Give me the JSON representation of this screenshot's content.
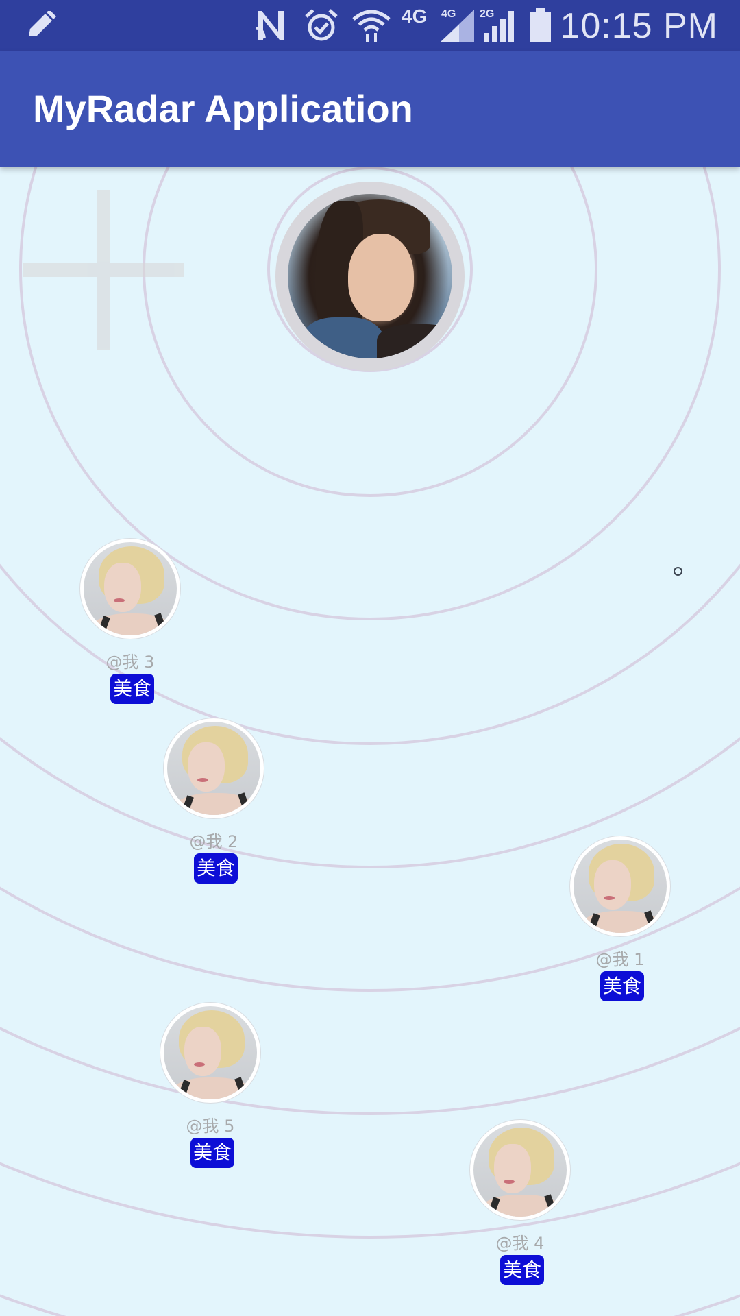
{
  "status_bar": {
    "time": "10:15 PM",
    "network_4g": "4G",
    "signal_4g_label": "4G",
    "signal_2g_label": "2G",
    "icons": [
      "edit-icon",
      "nfc-icon",
      "alarm-icon",
      "wifi-icon",
      "signal-icon",
      "battery-icon"
    ]
  },
  "app_bar": {
    "title": "MyRadar Application",
    "background_color": "#3d52b4"
  },
  "radar": {
    "ring_color": "#d8d2e4",
    "background_color": "#e3f5fc",
    "center_avatar": "user-avatar-center",
    "nodes": [
      {
        "name": "@我 3",
        "tag": "美食"
      },
      {
        "name": "@我 2",
        "tag": "美食"
      },
      {
        "name": "@我 1",
        "tag": "美食"
      },
      {
        "name": "@我 5",
        "tag": "美食"
      },
      {
        "name": "@我 4",
        "tag": "美食"
      }
    ],
    "tag_color": "#0d0ed6"
  }
}
